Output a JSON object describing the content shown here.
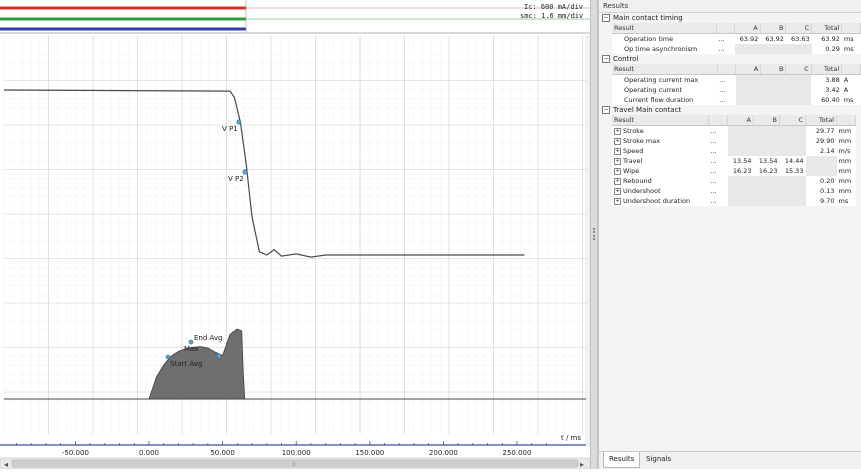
{
  "chart": {
    "scales": {
      "ic": "Ic: 600 mA/div",
      "smc": "smc: 1.6 mm/div"
    },
    "x_axis_label": "t / ms",
    "x_ticks": [
      "-50.000",
      "0.000",
      "50.000",
      "100.000",
      "150.000",
      "200.000",
      "250.000"
    ],
    "markers": {
      "vp1": "V P1",
      "vp2": "V P2",
      "end_avg": "End Avg",
      "max": "Max",
      "start_avg": "Start Avg"
    },
    "colors": {
      "trace1": "#d32f2f",
      "trace2": "#2e9e3a",
      "trace3": "#2f3f9e",
      "travel": "#4a4a4a",
      "current_fill": "#6f6f6f",
      "marker": "#5aa9d0"
    }
  },
  "chart_data": {
    "type": "line",
    "xlabel": "t / ms",
    "x_ticks": [
      -50,
      0,
      50,
      100,
      150,
      200,
      250
    ],
    "series": [
      {
        "name": "smc",
        "x": [
          -100,
          55,
          58,
          62,
          66,
          70,
          75,
          80,
          85,
          90,
          100,
          110,
          120,
          150,
          200,
          255
        ],
        "y": [
          26.5,
          26.4,
          25.8,
          23.5,
          19.5,
          14.5,
          11.2,
          10.9,
          11.4,
          10.8,
          11.0,
          10.7,
          10.9,
          10.9,
          10.9,
          10.9
        ]
      },
      {
        "name": "Ic",
        "x": [
          0,
          5,
          10,
          15,
          20,
          25,
          30,
          35,
          40,
          45,
          50,
          55,
          60,
          63,
          64,
          65
        ],
        "y": [
          0,
          3.2,
          5.0,
          6.3,
          7.0,
          7.4,
          7.6,
          7.7,
          7.5,
          6.9,
          6.4,
          9.5,
          10.3,
          10.0,
          4.0,
          0
        ]
      }
    ]
  },
  "results": {
    "title": "Results",
    "sections": [
      {
        "title": "Main contact timing",
        "headers": [
          "Result",
          "A",
          "B",
          "C",
          "Total"
        ],
        "rows": [
          {
            "name": "Operation time",
            "dots": "...",
            "a": "63.92",
            "b": "63.92",
            "c": "63.63",
            "total": "63.92",
            "unit": "ms"
          },
          {
            "name": "Op time asynchronism",
            "dots": "...",
            "a": "",
            "b": "",
            "c": "",
            "total": "0.29",
            "unit": "ms"
          }
        ]
      },
      {
        "title": "Control",
        "headers": [
          "Result",
          "A",
          "B",
          "C",
          "Total"
        ],
        "rows": [
          {
            "name": "Operating current max",
            "dots": "...",
            "a": "",
            "b": "",
            "c": "",
            "total": "3.88",
            "unit": "A"
          },
          {
            "name": "Operating current",
            "dots": "...",
            "a": "",
            "b": "",
            "c": "",
            "total": "3.42",
            "unit": "A"
          },
          {
            "name": "Current flow duration",
            "dots": "...",
            "a": "",
            "b": "",
            "c": "",
            "total": "60.40",
            "unit": "ms"
          }
        ]
      },
      {
        "title": "Travel Main contact",
        "headers": [
          "Result",
          "A",
          "B",
          "C",
          "Total"
        ],
        "rows": [
          {
            "name": "Stroke",
            "dots": "...",
            "a": "",
            "b": "",
            "c": "",
            "total": "29.77",
            "unit": "mm"
          },
          {
            "name": "Stroke max",
            "dots": "...",
            "a": "",
            "b": "",
            "c": "",
            "total": "29.90",
            "unit": "mm"
          },
          {
            "name": "Speed",
            "dots": "...",
            "a": "",
            "b": "",
            "c": "",
            "total": "2.14",
            "unit": "m/s"
          },
          {
            "name": "Travel",
            "dots": "...",
            "a": "13.54",
            "b": "13.54",
            "c": "14.44",
            "total": "",
            "unit": "mm"
          },
          {
            "name": "Wipe",
            "dots": "...",
            "a": "16.23",
            "b": "16.23",
            "c": "15.33",
            "total": "",
            "unit": "mm"
          },
          {
            "name": "Rebound",
            "dots": "...",
            "a": "",
            "b": "",
            "c": "",
            "total": "0.20",
            "unit": "mm"
          },
          {
            "name": "Undershoot",
            "dots": "...",
            "a": "",
            "b": "",
            "c": "",
            "total": "0.13",
            "unit": "mm"
          },
          {
            "name": "Undershoot duration",
            "dots": "...",
            "a": "",
            "b": "",
            "c": "",
            "total": "9.70",
            "unit": "ms"
          }
        ]
      }
    ]
  },
  "tabs": {
    "results": "Results",
    "signals": "Signals"
  },
  "icons": {
    "collapse": "minus-box-icon",
    "expand": "plus-box-icon"
  }
}
